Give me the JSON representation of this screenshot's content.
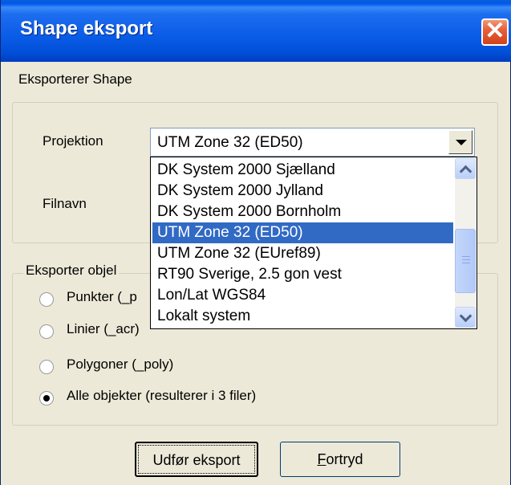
{
  "window": {
    "title": "Shape eksport",
    "close_glyph": "✕"
  },
  "subtitle": "Eksporterer Shape",
  "projection": {
    "label": "Projektion",
    "selected": "UTM Zone 32 (ED50)",
    "options": [
      "DK System 2000 Sjælland",
      "DK System 2000 Jylland",
      "DK System 2000 Bornholm",
      "UTM Zone 32 (ED50)",
      "UTM Zone 32 (EUref89)",
      "RT90 Sverige, 2.5 gon vest",
      "Lon/Lat WGS84",
      "Lokalt system"
    ]
  },
  "filename": {
    "label": "Filnavn"
  },
  "export_group": {
    "legend": "Eksporter objel",
    "options": [
      {
        "label": "Punkter (_p",
        "checked": false
      },
      {
        "label": "Linier (_acr)",
        "checked": false
      },
      {
        "label": "Polygoner (_poly)",
        "checked": false
      },
      {
        "label": "Alle objekter (resulterer i 3 filer)",
        "checked": true
      }
    ]
  },
  "buttons": {
    "export": "Udfør eksport",
    "cancel": "Fortryd"
  },
  "icons": {
    "close": "close-icon",
    "combo_arrow": "chevron-down-icon",
    "scroll_up": "scroll-up-icon",
    "scroll_down": "scroll-down-icon"
  }
}
